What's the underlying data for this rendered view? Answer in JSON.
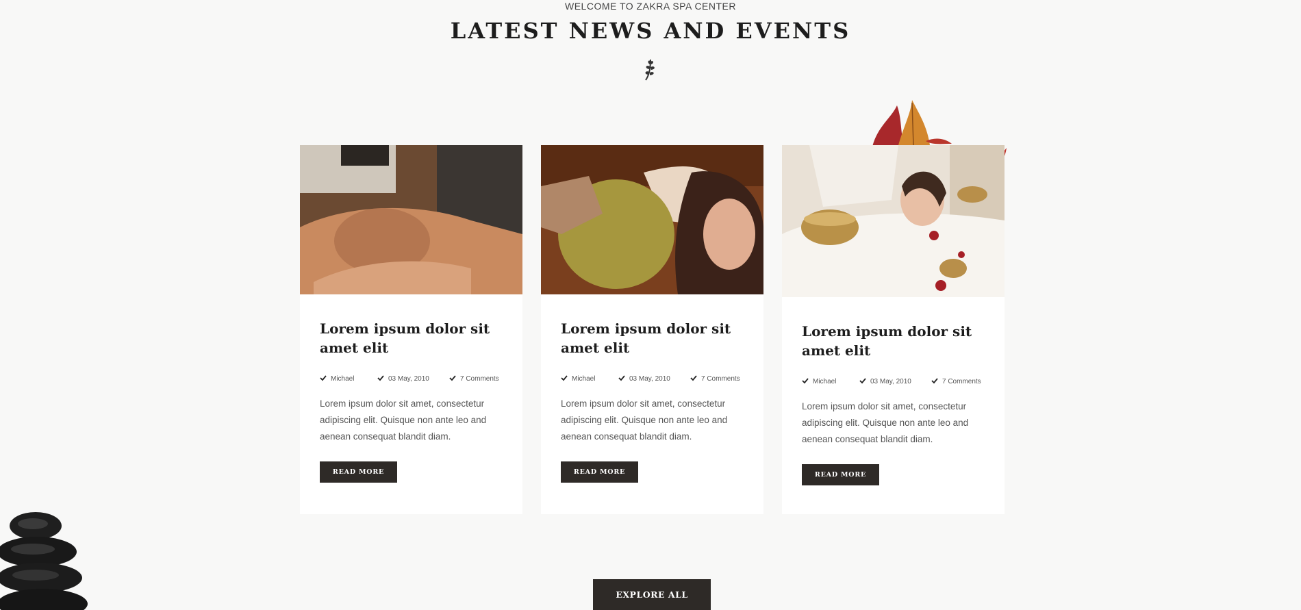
{
  "header": {
    "eyebrow": "WELCOME TO ZAKRA SPA CENTER",
    "title": "LATEST NEWS AND EVENTS",
    "divider_icon": "leaf-sprig-icon"
  },
  "decorations": {
    "top_right": "autumn-leaves",
    "bottom_left": "stacked-spa-stones"
  },
  "posts": [
    {
      "image": "facial-massage-photo",
      "title": "Lorem ipsum dolor sit amet elit",
      "author": "Michael",
      "date": "03 May, 2010",
      "comments": "7 Comments",
      "excerpt": "Lorem ipsum dolor sit amet, consectetur adipiscing elit. Quisque non ante leo and aenean consequat blandit diam.",
      "button_label": "READ MORE"
    },
    {
      "image": "clay-body-mask-photo",
      "title": "Lorem ipsum dolor sit amet elit",
      "author": "Michael",
      "date": "03 May, 2010",
      "comments": "7 Comments",
      "excerpt": "Lorem ipsum dolor sit amet, consectetur adipiscing elit. Quisque non ante leo and aenean consequat blandit diam.",
      "button_label": "READ MORE"
    },
    {
      "image": "singing-bowl-therapy-photo",
      "title": "Lorem ipsum dolor sit amet elit",
      "author": "Michael",
      "date": "03 May, 2010",
      "comments": "7 Comments",
      "excerpt": "Lorem ipsum dolor sit amet, consectetur adipiscing elit. Quisque non ante leo and aenean consequat blandit diam.",
      "button_label": "READ MORE"
    }
  ],
  "cta": {
    "explore_label": "EXPLORE ALL"
  },
  "colors": {
    "background": "#f8f8f7",
    "card": "#ffffff",
    "button": "#2e2a27",
    "heading": "#1d1d1d",
    "body_text": "#555555"
  }
}
